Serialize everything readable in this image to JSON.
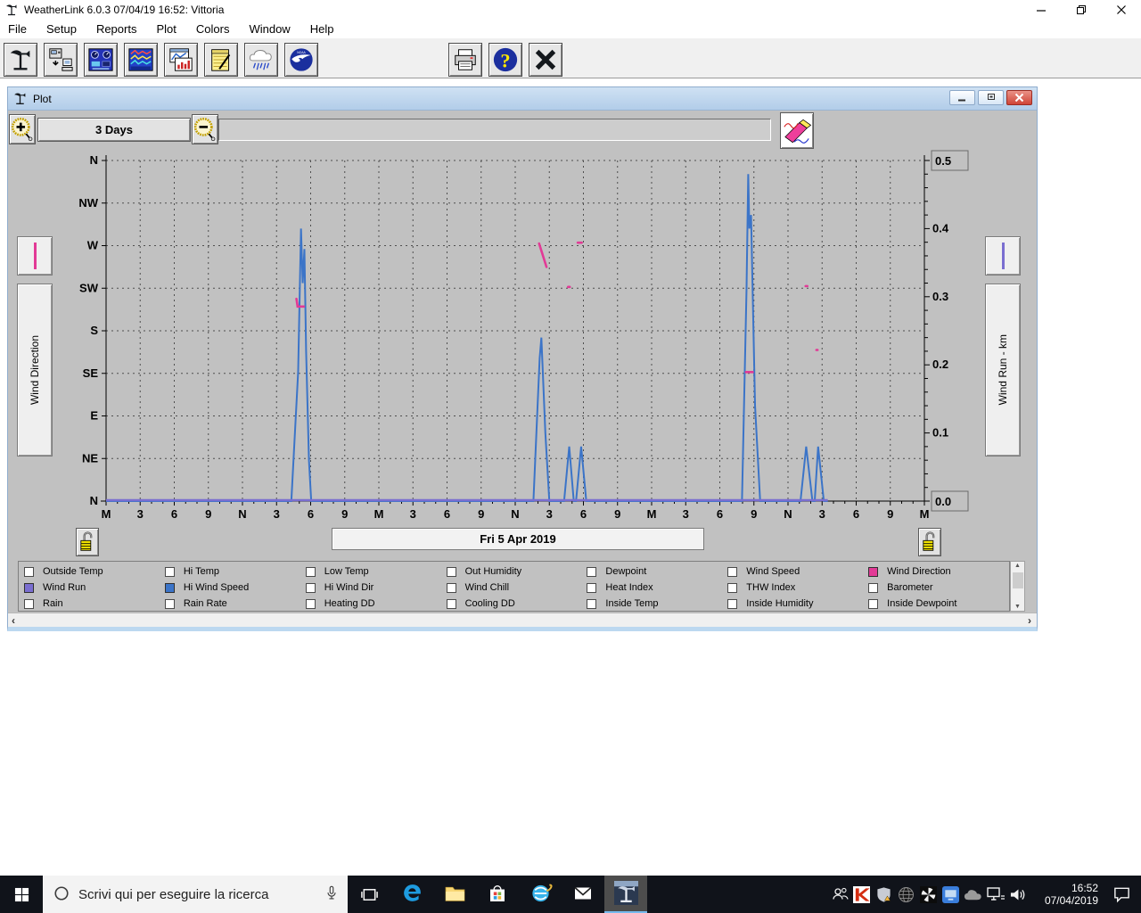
{
  "window": {
    "title": "WeatherLink 6.0.3 07/04/19 16:52: Vittoria"
  },
  "menu": {
    "items": [
      "File",
      "Setup",
      "Reports",
      "Plot",
      "Colors",
      "Window",
      "Help"
    ]
  },
  "toolbar": {
    "buttons": [
      {
        "name": "station",
        "icon": "wind-vane-icon",
        "gap": false
      },
      {
        "name": "download",
        "icon": "download-icon",
        "gap": false
      },
      {
        "name": "bulletin",
        "icon": "bulletin-icon",
        "gap": false
      },
      {
        "name": "strip-charts",
        "icon": "strip-chart-icon",
        "gap": false
      },
      {
        "name": "plot",
        "icon": "plot-icon",
        "gap": false
      },
      {
        "name": "notes",
        "icon": "notes-icon",
        "gap": false
      },
      {
        "name": "rain",
        "icon": "rain-icon",
        "gap": false
      },
      {
        "name": "noaa-summary",
        "icon": "noaa-icon",
        "gap": false
      },
      {
        "name": "print",
        "icon": "print-icon",
        "gap": true
      },
      {
        "name": "help",
        "icon": "help-icon",
        "gap": false
      },
      {
        "name": "exit",
        "icon": "exit-icon",
        "gap": false
      }
    ]
  },
  "plot_window": {
    "title": "Plot",
    "range_label": "3 Days",
    "date_label": "Fri 5 Apr 2019",
    "left_axis_button": "Wind Direction",
    "right_axis_button": "Wind Run - km"
  },
  "chart_data": {
    "type": "line",
    "title": "",
    "x_axis": {
      "hours_total": 72,
      "days": 3,
      "tick_labels": [
        "M",
        "3",
        "6",
        "9",
        "N",
        "3",
        "6",
        "9",
        "M",
        "3",
        "6",
        "9",
        "N",
        "3",
        "6",
        "9",
        "M",
        "3",
        "6",
        "9",
        "N",
        "3",
        "6",
        "9",
        "M"
      ]
    },
    "left_axis": {
      "title": "Wind Direction",
      "labels_top_to_bottom": [
        "N",
        "NW",
        "W",
        "SW",
        "S",
        "SE",
        "E",
        "NE",
        "N"
      ]
    },
    "right_axis": {
      "title": "Wind Run - km",
      "min": 0,
      "max": 0.5,
      "max_label": "0.5",
      "min_label": "0.0",
      "mid_labels": [
        "0.4",
        "0.3",
        "0.2",
        "0.1"
      ],
      "mid_values": [
        0.4,
        0.3,
        0.2,
        0.1
      ],
      "minor_tick": 0.02,
      "major_tick": 0.1
    },
    "data_end_hour": 63.5,
    "series": [
      {
        "name": "Hi Wind Speed",
        "color": "#3b74c8",
        "axis": "right",
        "points": [
          [
            0,
            0
          ],
          [
            16.3,
            0
          ],
          [
            16.9,
            0.19
          ],
          [
            17.15,
            0.4
          ],
          [
            17.3,
            0.32
          ],
          [
            17.45,
            0.37
          ],
          [
            17.6,
            0.22
          ],
          [
            17.85,
            0.06
          ],
          [
            18.05,
            0
          ],
          [
            37.6,
            0
          ],
          [
            38.15,
            0.21
          ],
          [
            38.3,
            0.24
          ],
          [
            38.65,
            0.1
          ],
          [
            39.0,
            0
          ],
          [
            40.3,
            0
          ],
          [
            40.75,
            0.08
          ],
          [
            41.15,
            0
          ],
          [
            41.35,
            0
          ],
          [
            41.8,
            0.08
          ],
          [
            42.25,
            0
          ],
          [
            55.95,
            0
          ],
          [
            56.35,
            0.31
          ],
          [
            56.5,
            0.48
          ],
          [
            56.6,
            0.4
          ],
          [
            56.75,
            0.42
          ],
          [
            57.1,
            0.14
          ],
          [
            57.55,
            0
          ],
          [
            61.1,
            0
          ],
          [
            61.6,
            0.08
          ],
          [
            62.15,
            0
          ],
          [
            62.35,
            0
          ],
          [
            62.65,
            0.08
          ],
          [
            63.15,
            0
          ],
          [
            63.5,
            0
          ]
        ]
      },
      {
        "name": "Wind Run",
        "color": "#7a6ed0",
        "axis": "right",
        "points": [
          [
            0,
            0
          ],
          [
            63.5,
            0
          ]
        ]
      },
      {
        "name": "Wind Direction",
        "color": "#e23a96",
        "axis": "left",
        "direction_scale_note": "0 = N bottom, 8 = N top, one unit per compass step",
        "segments": [
          [
            [
              16.75,
              4.75
            ],
            [
              16.85,
              4.57
            ],
            [
              17.4,
              4.57
            ]
          ],
          [
            [
              38.1,
              6.05
            ],
            [
              38.75,
              5.5
            ]
          ],
          [
            [
              41.5,
              6.07
            ],
            [
              41.85,
              6.07
            ]
          ],
          [
            [
              40.65,
              5.03
            ],
            [
              40.8,
              5.03
            ]
          ],
          [
            [
              56.3,
              3.03
            ],
            [
              56.9,
              3.03
            ]
          ],
          [
            [
              61.55,
              5.05
            ],
            [
              61.7,
              5.05
            ]
          ],
          [
            [
              62.5,
              3.55
            ],
            [
              62.6,
              3.55
            ]
          ]
        ]
      }
    ],
    "date_label": "Fri 5 Apr 2019"
  },
  "legend": {
    "items": [
      {
        "label": "Outside Temp",
        "checked": false
      },
      {
        "label": "Hi Temp",
        "checked": false
      },
      {
        "label": "Low Temp",
        "checked": false
      },
      {
        "label": "Out Humidity",
        "checked": false
      },
      {
        "label": "Dewpoint",
        "checked": false
      },
      {
        "label": "Wind Speed",
        "checked": false
      },
      {
        "label": "Wind Direction",
        "checked": true,
        "color": "#e23a96"
      },
      {
        "label": "Wind Run",
        "checked": true,
        "color": "#7a6ed0"
      },
      {
        "label": "Hi Wind Speed",
        "checked": true,
        "color": "#3b74c8"
      },
      {
        "label": "Hi Wind Dir",
        "checked": false
      },
      {
        "label": "Wind Chill",
        "checked": false
      },
      {
        "label": "Heat Index",
        "checked": false
      },
      {
        "label": "THW Index",
        "checked": false
      },
      {
        "label": "Barometer",
        "checked": false
      },
      {
        "label": "Rain",
        "checked": false
      },
      {
        "label": "Rain Rate",
        "checked": false
      },
      {
        "label": "Heating DD",
        "checked": false
      },
      {
        "label": "Cooling DD",
        "checked": false
      },
      {
        "label": "Inside Temp",
        "checked": false
      },
      {
        "label": "Inside Humidity",
        "checked": false
      },
      {
        "label": "Inside Dewpoint",
        "checked": false
      }
    ]
  },
  "taskbar": {
    "search_placeholder": "Scrivi qui per eseguire la ricerca",
    "app_icons": [
      "edge",
      "file-explorer",
      "store",
      "internet-explorer",
      "mail",
      "weatherlink"
    ],
    "active_app": "weatherlink",
    "tray_icons": [
      "people",
      "kaspersky",
      "defender",
      "globe",
      "pinwheel",
      "pc",
      "onedrive",
      "network",
      "volume"
    ],
    "clock": {
      "time": "16:52",
      "date": "07/04/2019"
    }
  }
}
